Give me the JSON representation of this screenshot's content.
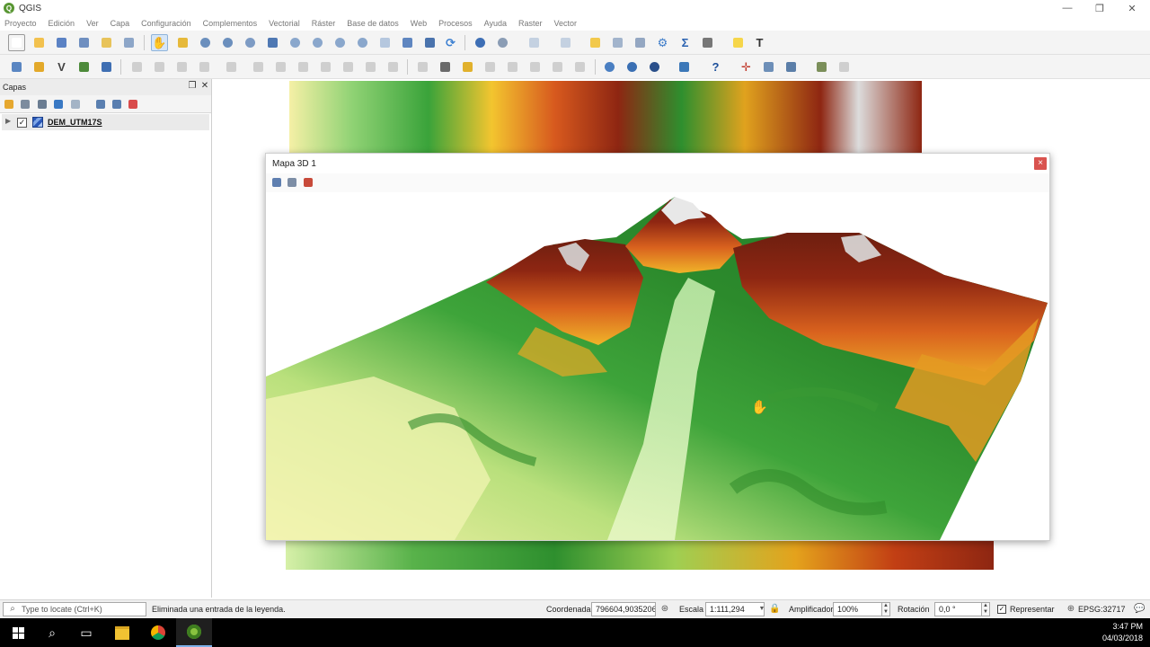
{
  "app": {
    "title": "QGIS",
    "menu": [
      "Proyecto",
      "Edición",
      "Ver",
      "Capa",
      "Configuración",
      "Complementos",
      "Vectorial",
      "Ráster",
      "Base de datos",
      "Web",
      "Procesos",
      "Ayuda",
      "Raster",
      "Vector"
    ]
  },
  "layers_panel": {
    "title": "Capas",
    "layers": [
      {
        "name": "DEM_UTM17S",
        "checked": true
      }
    ]
  },
  "map3d": {
    "title": "Mapa 3D 1",
    "close_label": "×"
  },
  "statusbar": {
    "locator_placeholder": "Type to locate (Ctrl+K)",
    "message": "Eliminada una entrada de la leyenda.",
    "coord_label": "Coordenada",
    "coord_value": "796604,9035206",
    "scale_label": "Escala",
    "scale_value": "1:111,294",
    "magnifier_label": "Amplificador",
    "magnifier_value": "100%",
    "rotation_label": "Rotación",
    "rotation_value": "0,0 °",
    "render_label": "Representar",
    "render_checked": true,
    "crs_label": "EPSG:32717"
  },
  "taskbar": {
    "time": "3:47 PM",
    "date": "04/03/2018"
  },
  "colors": {
    "accent": "#589632",
    "dem_low": "#f5f0a6",
    "dem_mid": "#2e8f2e",
    "dem_high": "#8e2612"
  }
}
